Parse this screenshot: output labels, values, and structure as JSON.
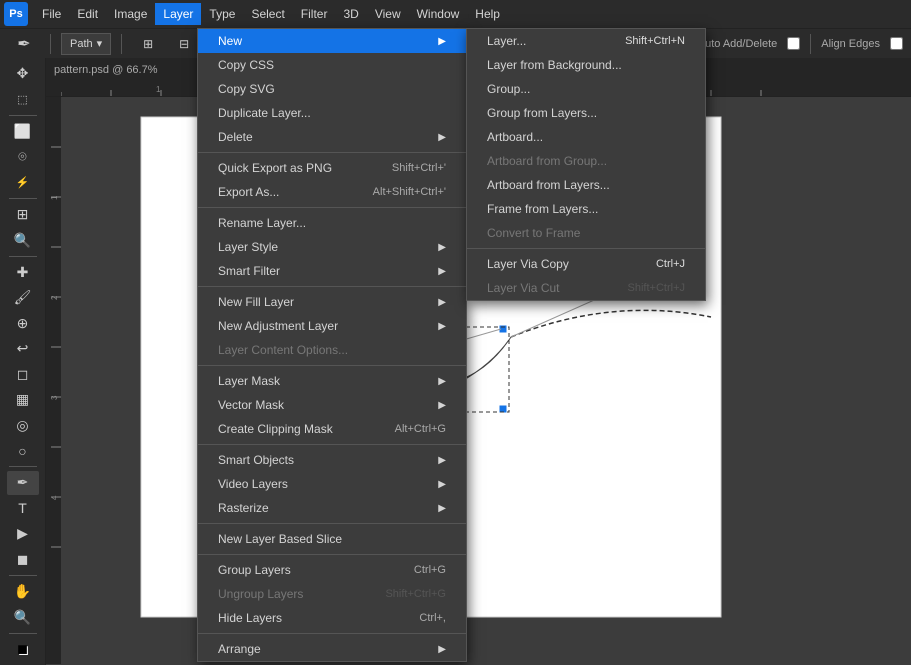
{
  "app": {
    "title": "Adobe Photoshop",
    "logo": "Ps",
    "document_title": "pattern.psd @ 66.7%"
  },
  "menubar": {
    "items": [
      {
        "id": "file",
        "label": "File"
      },
      {
        "id": "edit",
        "label": "Edit"
      },
      {
        "id": "image",
        "label": "Image"
      },
      {
        "id": "layer",
        "label": "Layer",
        "active": true
      },
      {
        "id": "type",
        "label": "Type"
      },
      {
        "id": "select",
        "label": "Select"
      },
      {
        "id": "filter",
        "label": "Filter"
      },
      {
        "id": "3d",
        "label": "3D"
      },
      {
        "id": "view",
        "label": "View"
      },
      {
        "id": "window",
        "label": "Window"
      },
      {
        "id": "help",
        "label": "Help"
      }
    ]
  },
  "toolbar": {
    "path_label": "Path",
    "auto_add_delete_label": "Auto Add/Delete",
    "align_edges_label": "Align Edges"
  },
  "layer_menu": {
    "items": [
      {
        "id": "new",
        "label": "New",
        "has_arrow": true,
        "highlighted": true
      },
      {
        "id": "copy_css",
        "label": "Copy CSS"
      },
      {
        "id": "copy_svg",
        "label": "Copy SVG"
      },
      {
        "id": "duplicate_layer",
        "label": "Duplicate Layer..."
      },
      {
        "id": "delete",
        "label": "Delete",
        "has_arrow": true
      },
      {
        "id": "sep1",
        "type": "separator"
      },
      {
        "id": "quick_export",
        "label": "Quick Export as PNG",
        "shortcut": "Shift+Ctrl+'"
      },
      {
        "id": "export_as",
        "label": "Export As...",
        "shortcut": "Alt+Shift+Ctrl+'"
      },
      {
        "id": "sep2",
        "type": "separator"
      },
      {
        "id": "rename_layer",
        "label": "Rename Layer..."
      },
      {
        "id": "layer_style",
        "label": "Layer Style",
        "has_arrow": true
      },
      {
        "id": "smart_filter",
        "label": "Smart Filter",
        "has_arrow": true,
        "disabled": false
      },
      {
        "id": "sep3",
        "type": "separator"
      },
      {
        "id": "new_fill_layer",
        "label": "New Fill Layer",
        "has_arrow": true
      },
      {
        "id": "new_adjustment_layer",
        "label": "New Adjustment Layer",
        "has_arrow": true
      },
      {
        "id": "layer_content_options",
        "label": "Layer Content Options...",
        "disabled": true
      },
      {
        "id": "sep4",
        "type": "separator"
      },
      {
        "id": "layer_mask",
        "label": "Layer Mask",
        "has_arrow": true
      },
      {
        "id": "vector_mask",
        "label": "Vector Mask",
        "has_arrow": true
      },
      {
        "id": "create_clipping_mask",
        "label": "Create Clipping Mask",
        "shortcut": "Alt+Ctrl+G"
      },
      {
        "id": "sep5",
        "type": "separator"
      },
      {
        "id": "smart_objects",
        "label": "Smart Objects",
        "has_arrow": true
      },
      {
        "id": "video_layers",
        "label": "Video Layers",
        "has_arrow": true
      },
      {
        "id": "rasterize",
        "label": "Rasterize",
        "has_arrow": true
      },
      {
        "id": "sep6",
        "type": "separator"
      },
      {
        "id": "new_layer_based_slice",
        "label": "New Layer Based Slice"
      },
      {
        "id": "sep7",
        "type": "separator"
      },
      {
        "id": "group_layers",
        "label": "Group Layers",
        "shortcut": "Ctrl+G"
      },
      {
        "id": "ungroup_layers",
        "label": "Ungroup Layers",
        "shortcut": "Shift+Ctrl+G",
        "disabled": true
      },
      {
        "id": "hide_layers",
        "label": "Hide Layers",
        "shortcut": "Ctrl+,"
      },
      {
        "id": "sep8",
        "type": "separator"
      },
      {
        "id": "arrange",
        "label": "Arrange",
        "has_arrow": true
      }
    ]
  },
  "new_submenu": {
    "items": [
      {
        "id": "layer",
        "label": "Layer...",
        "shortcut": "Shift+Ctrl+N"
      },
      {
        "id": "layer_from_background",
        "label": "Layer from Background..."
      },
      {
        "id": "group",
        "label": "Group..."
      },
      {
        "id": "group_from_layers",
        "label": "Group from Layers..."
      },
      {
        "id": "artboard",
        "label": "Artboard..."
      },
      {
        "id": "artboard_from_group",
        "label": "Artboard from Group...",
        "disabled": true
      },
      {
        "id": "artboard_from_layers",
        "label": "Artboard from Layers..."
      },
      {
        "id": "frame_from_layers",
        "label": "Frame from Layers..."
      },
      {
        "id": "convert_to_frame",
        "label": "Convert to Frame",
        "disabled": true
      },
      {
        "id": "sep1",
        "type": "separator"
      },
      {
        "id": "layer_via_copy",
        "label": "Layer Via Copy",
        "shortcut": "Ctrl+J"
      },
      {
        "id": "layer_via_cut",
        "label": "Layer Via Cut",
        "shortcut": "Shift+Ctrl+J",
        "disabled": true
      }
    ]
  },
  "tools": [
    {
      "id": "move",
      "icon": "✥"
    },
    {
      "id": "artboard",
      "icon": "⬚"
    },
    {
      "id": "sep1",
      "type": "separator"
    },
    {
      "id": "marquee",
      "icon": "⬜"
    },
    {
      "id": "lasso",
      "icon": "⌾"
    },
    {
      "id": "quick_select",
      "icon": "⚡"
    },
    {
      "id": "sep2",
      "type": "separator"
    },
    {
      "id": "crop",
      "icon": "⊞"
    },
    {
      "id": "eyedropper",
      "icon": "✏"
    },
    {
      "id": "sep3",
      "type": "separator"
    },
    {
      "id": "healing",
      "icon": "✚"
    },
    {
      "id": "brush",
      "icon": "🖌"
    },
    {
      "id": "clone",
      "icon": "⊕"
    },
    {
      "id": "history",
      "icon": "↩"
    },
    {
      "id": "eraser",
      "icon": "◻"
    },
    {
      "id": "gradient",
      "icon": "▦"
    },
    {
      "id": "blur",
      "icon": "◎"
    },
    {
      "id": "dodge",
      "icon": "○"
    },
    {
      "id": "sep4",
      "type": "separator"
    },
    {
      "id": "pen",
      "icon": "✒",
      "active": true
    },
    {
      "id": "type",
      "icon": "T"
    },
    {
      "id": "path_select",
      "icon": "▶"
    },
    {
      "id": "shape",
      "icon": "◼"
    },
    {
      "id": "sep5",
      "type": "separator"
    },
    {
      "id": "hand",
      "icon": "✋"
    },
    {
      "id": "zoom",
      "icon": "⊕"
    },
    {
      "id": "sep6",
      "type": "separator"
    },
    {
      "id": "foreground",
      "icon": "■"
    }
  ],
  "colors": {
    "menu_bg": "#3c3c3c",
    "menu_active": "#1473e6",
    "highlight_blue": "#1473e6",
    "toolbar_bg": "#2b2b2b",
    "disabled_text": "#777777",
    "canvas_bg": "#888888"
  }
}
